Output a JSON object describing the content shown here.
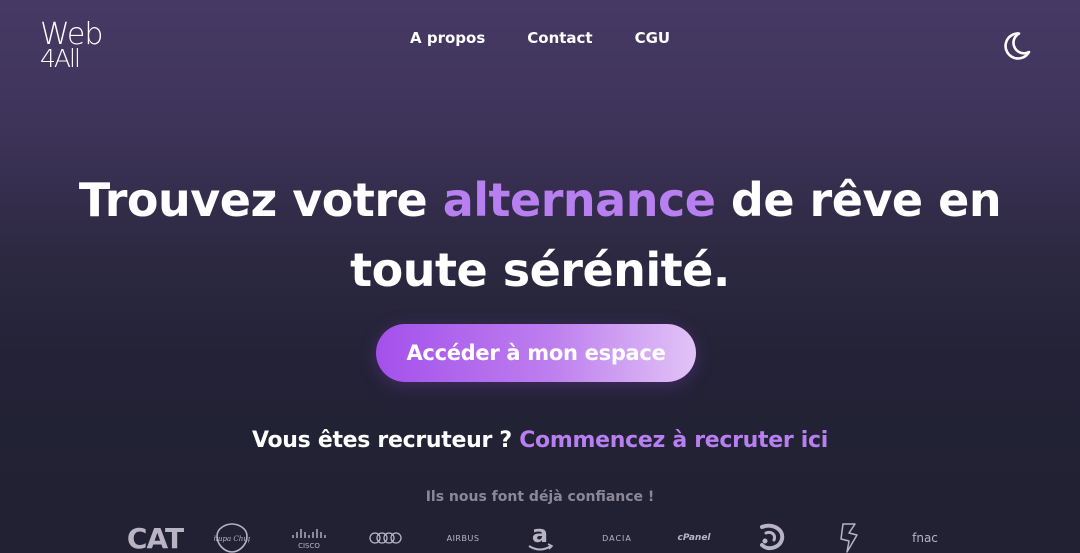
{
  "logo": {
    "line1": "Web",
    "line2": "4All"
  },
  "nav": {
    "items": [
      {
        "label": "A propos"
      },
      {
        "label": "Contact"
      },
      {
        "label": "CGU"
      }
    ]
  },
  "theme_toggle": {
    "icon": "moon-icon"
  },
  "hero": {
    "title_part1": "Trouvez votre ",
    "title_accent": "alternance",
    "title_part2": " de rêve en toute sérénité.",
    "accent_color": "#b77ff0"
  },
  "cta": {
    "label": "Accéder à mon espace"
  },
  "recruiter": {
    "question": "Vous êtes recruteur ?",
    "link_label": "Commencez à recruter ici"
  },
  "trust": {
    "heading": "Ils nous font déjà confiance !",
    "brands": [
      {
        "label": "CAT",
        "icon": "cat-logo-icon"
      },
      {
        "label": "Chupa Chups",
        "icon": "chupa-chups-logo-icon"
      },
      {
        "label": "CISCO",
        "icon": "cisco-logo-icon"
      },
      {
        "label": "",
        "icon": "audi-logo-icon"
      },
      {
        "label": "AIRBUS",
        "icon": "airbus-logo-icon"
      },
      {
        "label": "a",
        "icon": "amazon-logo-icon"
      },
      {
        "label": "DACIA",
        "icon": "dacia-logo-icon"
      },
      {
        "label": "cPanel",
        "icon": "cpanel-logo-icon"
      },
      {
        "label": "",
        "icon": "swirl-logo-icon"
      },
      {
        "label": "",
        "icon": "dassault-systemes-logo-icon"
      },
      {
        "label": "fnac",
        "icon": "fnac-logo-icon"
      }
    ]
  }
}
